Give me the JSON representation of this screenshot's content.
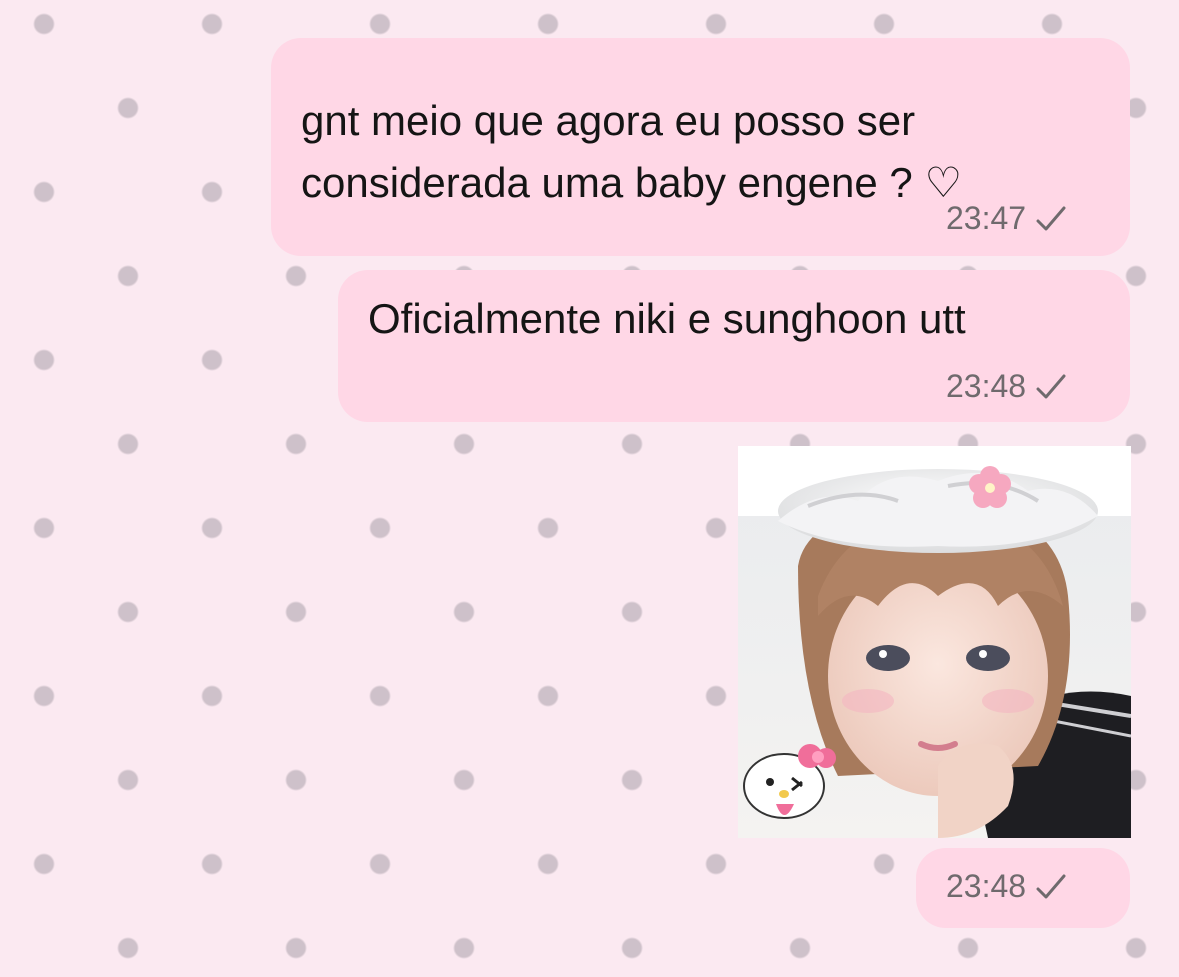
{
  "messages": [
    {
      "text": "gnt meio que agora eu posso ser\nconsiderada uma baby engene ? ♡",
      "time": "23:47",
      "status_icon": "check-icon"
    },
    {
      "text": "Oficialmente niki e sunghoon utt",
      "time": "23:48",
      "status_icon": "check-icon"
    },
    {
      "type": "image",
      "image_description_icon": "selfie-with-cream-hat-and-hello-kitty-sticker",
      "time": "23:48",
      "status_icon": "check-icon"
    }
  ],
  "colors": {
    "background": "#fbe9f1",
    "polka_dots": "#aaa0aa",
    "bubble": "#ffd7e6",
    "text": "#151515",
    "meta_text": "#6f6a6d"
  }
}
